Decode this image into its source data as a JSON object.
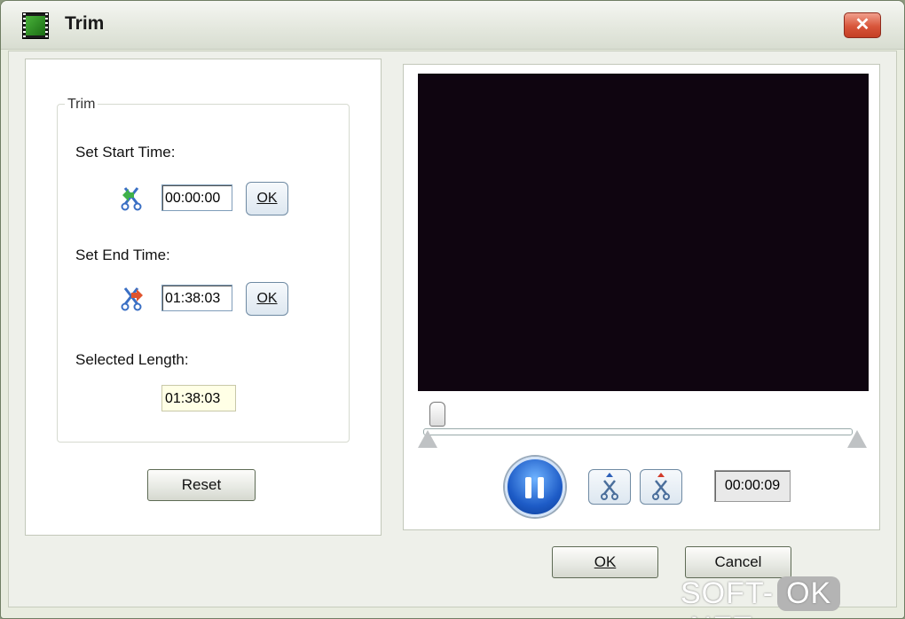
{
  "window": {
    "title": "Trim",
    "close_label": "✕"
  },
  "trim_group": {
    "legend": "Trim",
    "start_label": "Set Start Time:",
    "start_value": "00:00:00",
    "start_ok_label": "OK",
    "end_label": "Set End Time:",
    "end_value": "01:38:03",
    "end_ok_label": "OK",
    "length_label": "Selected Length:",
    "length_value": "01:38:03"
  },
  "left_panel": {
    "reset_label": "Reset"
  },
  "player": {
    "current_time": "00:00:09",
    "play_state": "pause",
    "progress_fraction": 0.03
  },
  "footer": {
    "ok_label": "OK",
    "cancel_label": "Cancel"
  },
  "watermark": {
    "part1": "SOFT-",
    "part2": "OK",
    "part3": ".NET"
  },
  "colors": {
    "video_bg": "#0f0510",
    "close_red": "#d8553a",
    "play_blue": "#1e5cc7"
  }
}
